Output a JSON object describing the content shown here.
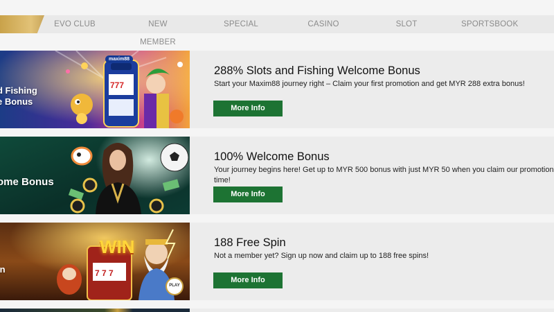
{
  "nav": {
    "items": [
      "EVO CLUB",
      "NEW MEMBER",
      "SPECIAL",
      "CASINO",
      "SLOT",
      "SPORTSBOOK"
    ]
  },
  "promos": [
    {
      "banner_text_1": "d Fishing",
      "banner_text_2": "e Bonus",
      "banner_logo": "maxim88",
      "title": "288% Slots and Fishing Welcome Bonus",
      "description": "Start your Maxim88 journey right – Claim your first promotion and get MYR 288 extra bonus!",
      "button": "More Info"
    },
    {
      "banner_text_1": "ome Bonus",
      "title": "100% Welcome Bonus",
      "description": "Your journey begins here! Get up to MYR 500 bonus with just MYR 50 when you claim our promotion time!",
      "button": "More Info"
    },
    {
      "banner_text_1": "in",
      "banner_win": "WIN",
      "banner_play": "PLAY",
      "title": "188 Free Spin",
      "description": "Not a member yet? Sign up now and claim up to 188 free spins!",
      "button": "More Info"
    }
  ],
  "colors": {
    "accent_green": "#1d7333",
    "gold": "#d4b062",
    "nav_bg": "#e9e9e9"
  }
}
